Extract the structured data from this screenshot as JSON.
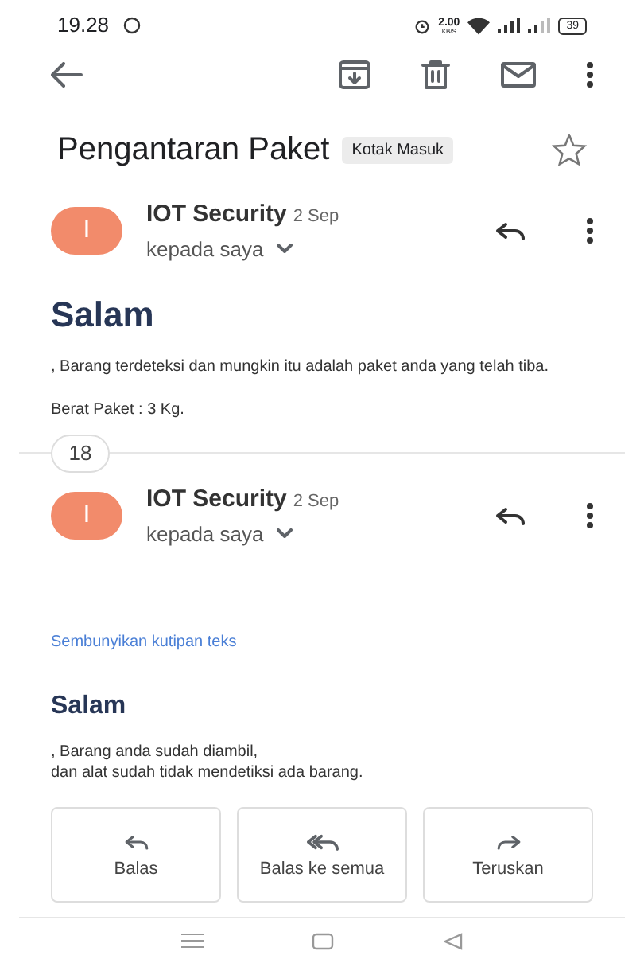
{
  "status_bar": {
    "time": "19.28",
    "speed": "2.00",
    "speed_unit": "KB/S",
    "battery": "39"
  },
  "subject": {
    "title": "Pengantaran Paket",
    "label": "Kotak Masuk",
    "starred": false
  },
  "messages": [
    {
      "kind": "message",
      "avatar": "I",
      "sender": "IOT Security",
      "date": "2 Sep",
      "recipient": "kepada saya",
      "heading": "Salam",
      "paragraphs": [
        ", Barang terdeteksi dan mungkin itu adalah paket anda yang telah tiba.",
        "Berat Paket : 3 Kg."
      ]
    },
    {
      "kind": "collapsed",
      "count": "18"
    },
    {
      "kind": "message",
      "avatar": "I",
      "sender": "IOT Security",
      "date": "2 Sep",
      "recipient": "kepada saya",
      "quote_link": "Sembunyikan kutipan teks",
      "heading": "Salam",
      "paragraphs": [
        ", Barang anda sudah diambil,\ndan alat sudah tidak mendetiksi ada barang."
      ]
    }
  ],
  "actions": [
    {
      "kind": "reply",
      "label": "Balas"
    },
    {
      "kind": "reply_all",
      "label": "Balas ke semua"
    },
    {
      "kind": "forward",
      "label": "Teruskan"
    }
  ]
}
